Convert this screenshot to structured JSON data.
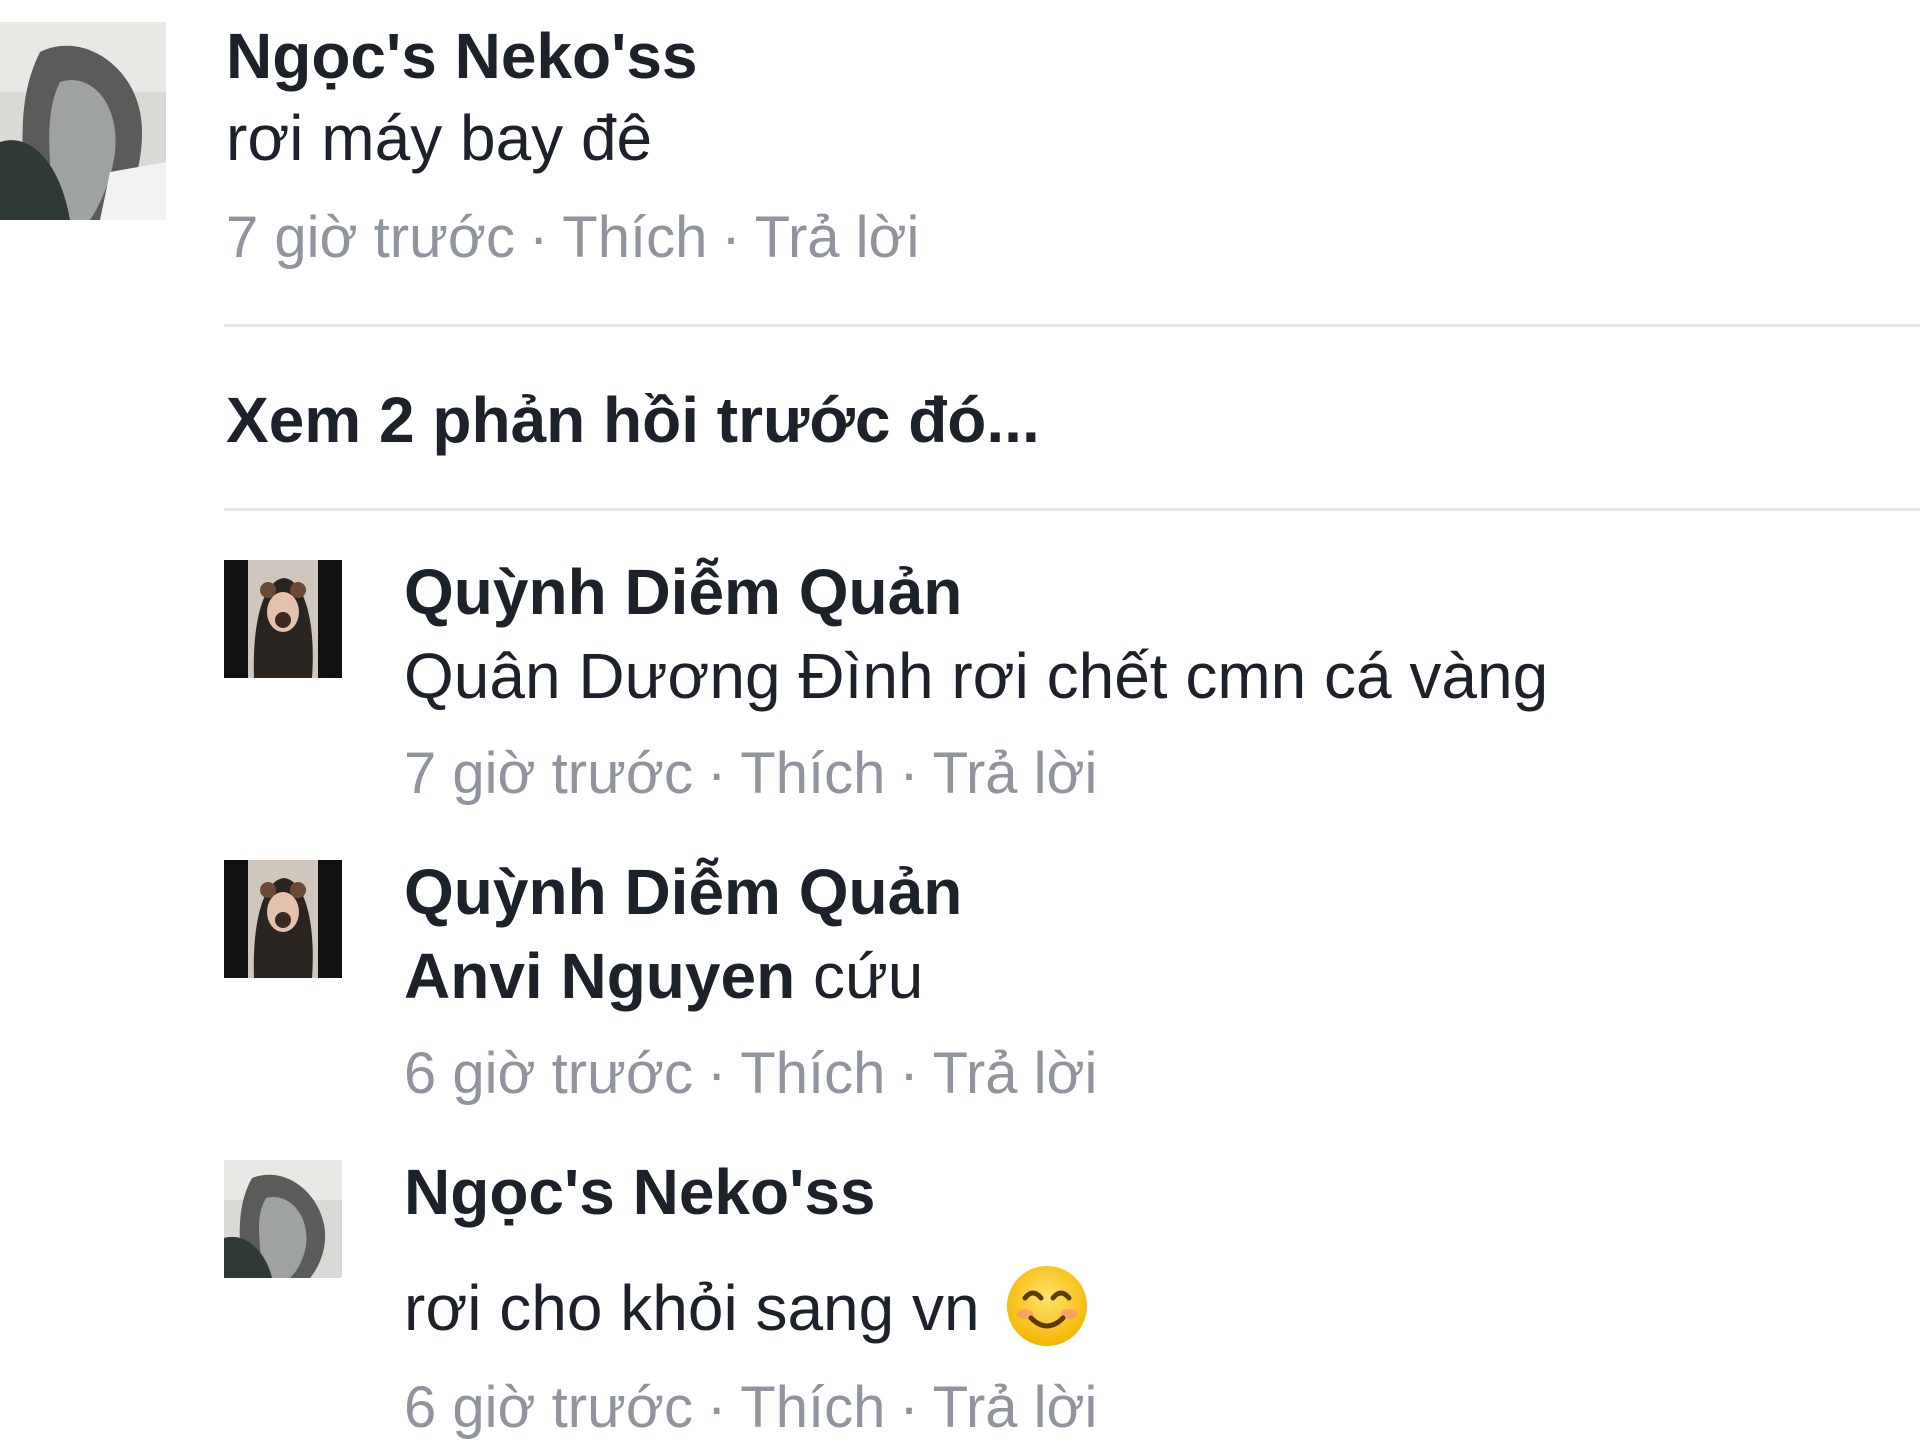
{
  "thread": {
    "top_comment": {
      "author": "Ngọc's Neko'ss",
      "text": "rơi máy bay đê",
      "time": "7 giờ trước",
      "like_label": "Thích",
      "reply_label": "Trả lời",
      "separator": "·"
    },
    "see_previous_label": "Xem 2 phản hồi trước đó...",
    "replies": [
      {
        "author": "Quỳnh Diễm Quản",
        "mention": "",
        "text": "Quân Dương Đình  rơi chết cmn cá vàng",
        "time": "7 giờ trước",
        "like_label": "Thích",
        "reply_label": "Trả lời"
      },
      {
        "author": "Quỳnh Diễm Quản",
        "mention": "Anvi Nguyen",
        "text": " cứu",
        "time": "6 giờ trước",
        "like_label": "Thích",
        "reply_label": "Trả lời"
      },
      {
        "author": "Ngọc's Neko'ss",
        "mention": "",
        "text": "rơi cho khỏi sang vn",
        "emoji": "smiling-face-emoji",
        "time": "6 giờ trước",
        "like_label": "Thích",
        "reply_label": "Trả lời"
      }
    ]
  },
  "colors": {
    "text": "#1d2129",
    "meta": "#90949c",
    "divider": "#e5e6e9"
  }
}
